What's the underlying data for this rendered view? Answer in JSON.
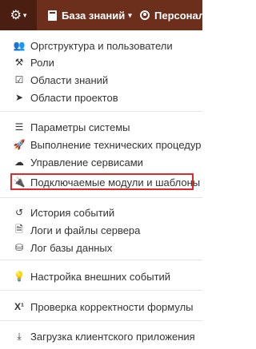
{
  "topbar": {
    "settings_icon": "gear-icon",
    "knowledge_base": "База знаний",
    "personal": "Персонал"
  },
  "menu": {
    "items": [
      {
        "label": "Оргструктура и пользователи",
        "icon": "users-icon"
      },
      {
        "label": "Роли",
        "icon": "gavel-icon"
      },
      {
        "label": "Области знаний",
        "icon": "check-square-icon"
      },
      {
        "label": "Области проектов",
        "icon": "paper-plane-icon"
      },
      {
        "label": "Параметры системы",
        "icon": "list-icon"
      },
      {
        "label": "Выполнение технических процедур",
        "icon": "rocket-icon"
      },
      {
        "label": "Управление сервисами",
        "icon": "cloud-icon"
      },
      {
        "label": "Подключаемые модули и шаблоны",
        "icon": "plug-icon"
      },
      {
        "label": "История событий",
        "icon": "history-icon"
      },
      {
        "label": "Логи и файлы сервера",
        "icon": "file-icon"
      },
      {
        "label": "Лог базы данных",
        "icon": "database-icon"
      },
      {
        "label": "Настройка внешних событий",
        "icon": "lightbulb-icon"
      },
      {
        "label": "Проверка корректности формулы",
        "icon": "superscript-icon"
      },
      {
        "label": "Загрузка клиентского приложения",
        "icon": "download-icon"
      }
    ]
  },
  "colors": {
    "topbar": "#6b2f1c",
    "topbar_active": "#4a1f12",
    "highlight": "#e02a2a"
  }
}
